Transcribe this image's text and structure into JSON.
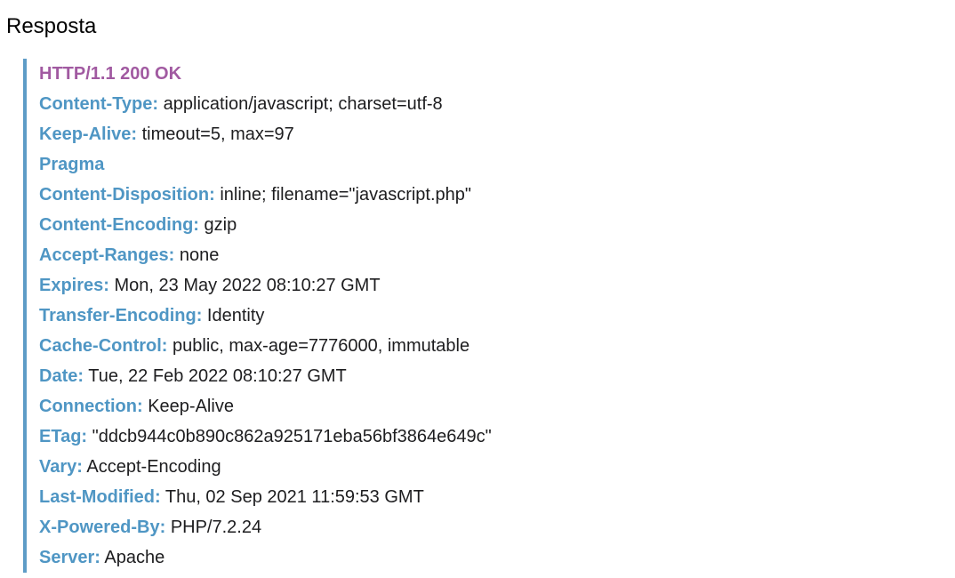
{
  "section": {
    "title": "Resposta"
  },
  "response": {
    "status_line": "HTTP/1.1 200 OK",
    "headers": [
      {
        "name": "Content-Type:",
        "value": "application/javascript; charset=utf-8"
      },
      {
        "name": "Keep-Alive:",
        "value": "timeout=5, max=97"
      },
      {
        "name": "Pragma",
        "value": ""
      },
      {
        "name": "Content-Disposition:",
        "value": "inline; filename=\"javascript.php\""
      },
      {
        "name": "Content-Encoding:",
        "value": "gzip"
      },
      {
        "name": "Accept-Ranges:",
        "value": "none"
      },
      {
        "name": "Expires:",
        "value": "Mon, 23 May 2022 08:10:27 GMT"
      },
      {
        "name": "Transfer-Encoding:",
        "value": "Identity"
      },
      {
        "name": "Cache-Control:",
        "value": "public, max-age=7776000, immutable"
      },
      {
        "name": "Date:",
        "value": "Tue, 22 Feb 2022 08:10:27 GMT"
      },
      {
        "name": "Connection:",
        "value": "Keep-Alive"
      },
      {
        "name": "ETag:",
        "value": "\"ddcb944c0b890c862a925171eba56bf3864e649c\""
      },
      {
        "name": "Vary:",
        "value": "Accept-Encoding"
      },
      {
        "name": "Last-Modified:",
        "value": "Thu, 02 Sep 2021 11:59:53 GMT"
      },
      {
        "name": "X-Powered-By:",
        "value": "PHP/7.2.24"
      },
      {
        "name": "Server:",
        "value": "Apache"
      }
    ]
  },
  "colors": {
    "status": "#a15aa1",
    "header_name": "#4f96c4",
    "border": "#5e9cc7",
    "text": "#1d1d1f"
  }
}
